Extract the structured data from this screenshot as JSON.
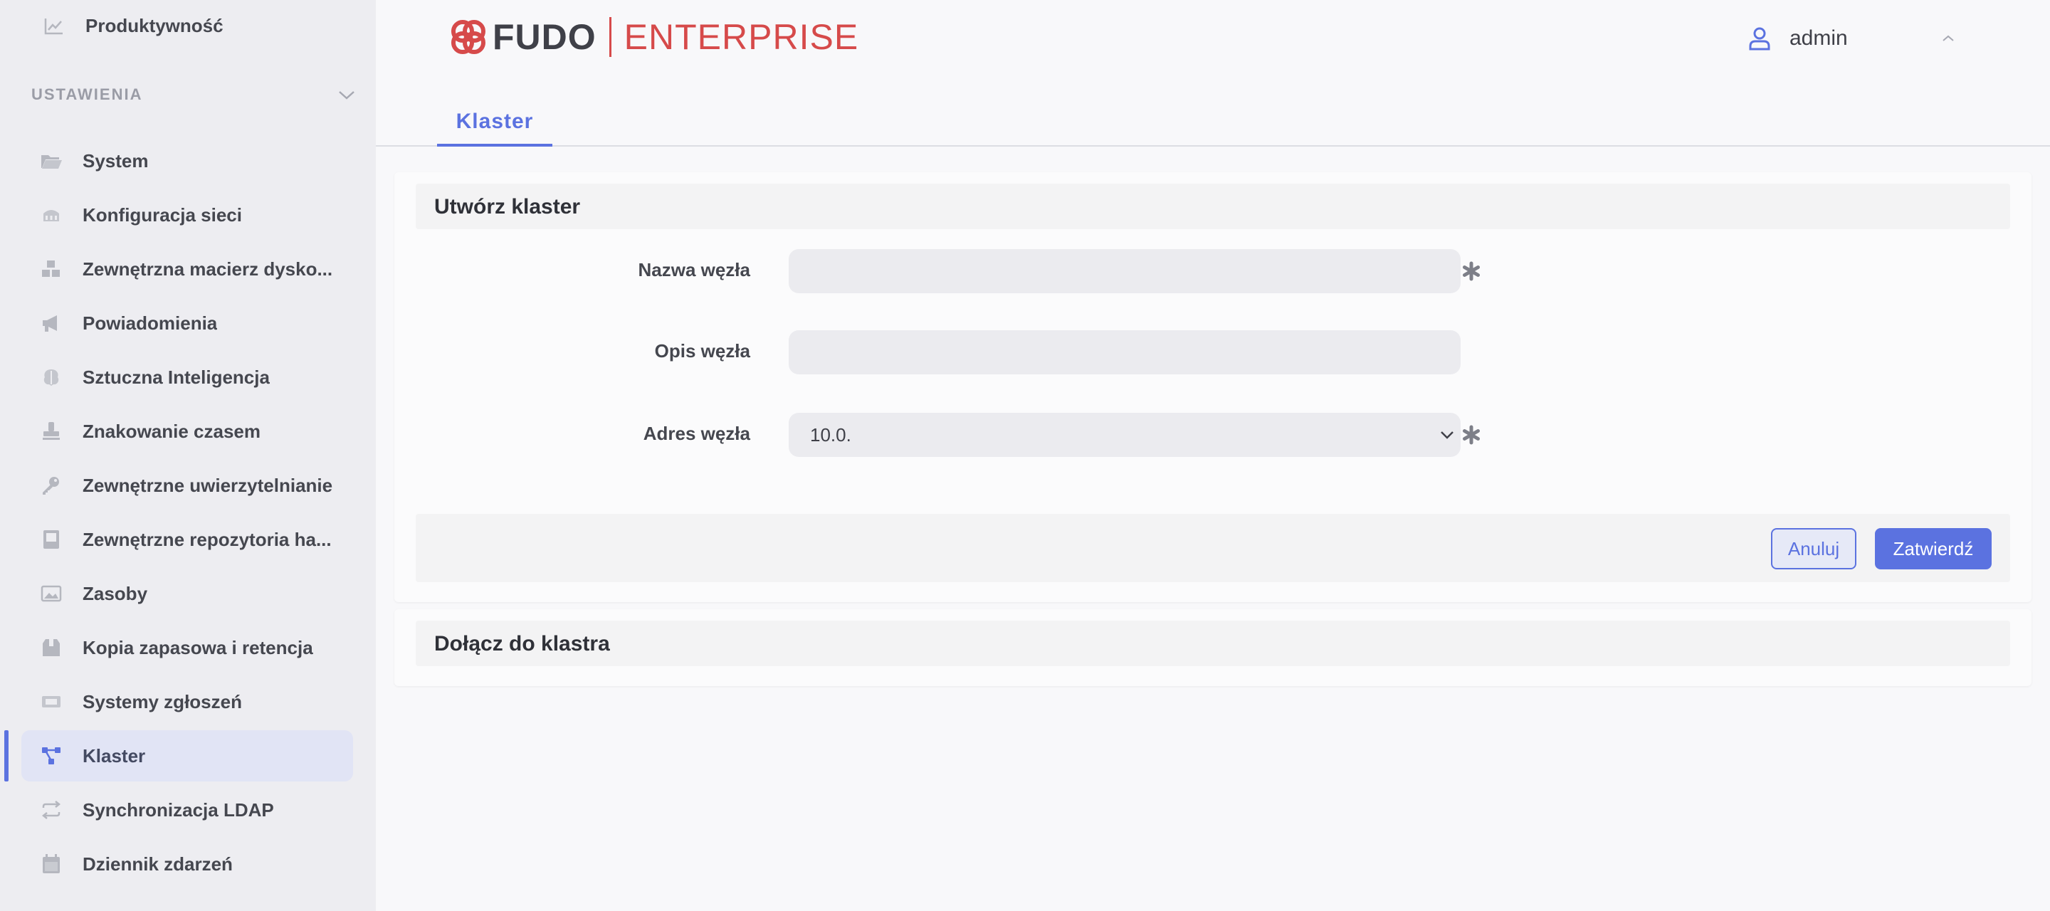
{
  "sidebar": {
    "top_item": {
      "label": "Produktywność",
      "icon": "chart-line-icon"
    },
    "section_title": "USTAWIENIA",
    "items": [
      {
        "label": "System",
        "icon": "folder-open-icon",
        "active": false
      },
      {
        "label": "Konfiguracja sieci",
        "icon": "network-icon",
        "active": false
      },
      {
        "label": "Zewnętrzna macierz dysko...",
        "icon": "boxes-icon",
        "active": false
      },
      {
        "label": "Powiadomienia",
        "icon": "megaphone-icon",
        "active": false
      },
      {
        "label": "Sztuczna Inteligencja",
        "icon": "brain-icon",
        "active": false
      },
      {
        "label": "Znakowanie czasem",
        "icon": "stamp-icon",
        "active": false
      },
      {
        "label": "Zewnętrzne uwierzytelnianie",
        "icon": "key-icon",
        "active": false
      },
      {
        "label": "Zewnętrzne repozytoria ha...",
        "icon": "book-icon",
        "active": false
      },
      {
        "label": "Zasoby",
        "icon": "images-icon",
        "active": false
      },
      {
        "label": "Kopia zapasowa i retencja",
        "icon": "archive-box-icon",
        "active": false
      },
      {
        "label": "Systemy zgłoszeń",
        "icon": "ticket-icon",
        "active": false
      },
      {
        "label": "Klaster",
        "icon": "cluster-icon",
        "active": true
      },
      {
        "label": "Synchronizacja LDAP",
        "icon": "sync-icon",
        "active": false
      },
      {
        "label": "Dziennik zdarzeń",
        "icon": "calendar-icon",
        "active": false
      }
    ]
  },
  "header": {
    "logo_brand": "FUDO",
    "logo_product": "ENTERPRISE",
    "user_name": "admin"
  },
  "tabs": [
    {
      "label": "Klaster",
      "active": true
    }
  ],
  "create_cluster": {
    "title": "Utwórz klaster",
    "fields": {
      "node_name": {
        "label": "Nazwa węzła",
        "value": "",
        "required": true
      },
      "node_description": {
        "label": "Opis węzła",
        "value": "",
        "required": false
      },
      "node_address": {
        "label": "Adres węzła",
        "value": "10.0.",
        "required": true
      }
    },
    "cancel_label": "Anuluj",
    "submit_label": "Zatwierdź"
  },
  "join_cluster": {
    "title": "Dołącz do klastra"
  },
  "colors": {
    "accent": "#5b72e0",
    "brand_red": "#d64a4a",
    "sidebar_bg": "#ededf1",
    "active_item_bg": "#e1e4f5"
  }
}
